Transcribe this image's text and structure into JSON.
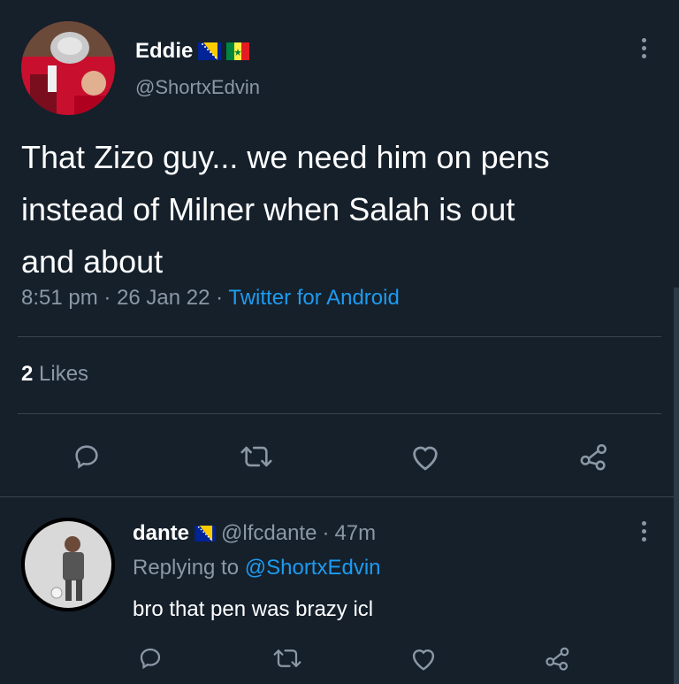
{
  "tweet": {
    "display_name": "Eddie",
    "handle": "@ShortxEdvin",
    "text_lines": [
      "That Zizo guy... we need him on pens",
      "instead of Milner when Salah is out",
      "and about"
    ],
    "time": "8:51 pm",
    "date": "26 Jan 22",
    "sep": "·",
    "source": "Twitter for Android",
    "likes_count": "2",
    "likes_label": "Likes"
  },
  "reply": {
    "display_name": "dante",
    "handle": "@lfcdante",
    "sep": "·",
    "age": "47m",
    "replying_prefix": "Replying to",
    "replying_to": "@ShortxEdvin",
    "text": "bro that pen was brazy icl"
  },
  "icons": {
    "reply": "speech-bubble-icon",
    "retweet": "retweet-icon",
    "like": "heart-icon",
    "share": "share-nodes-icon",
    "more": "vertical-dots-icon"
  },
  "colors": {
    "background": "#15202b",
    "text": "#ffffff",
    "muted": "#8b98a5",
    "link": "#1d9bf0",
    "divider": "#38444d"
  }
}
